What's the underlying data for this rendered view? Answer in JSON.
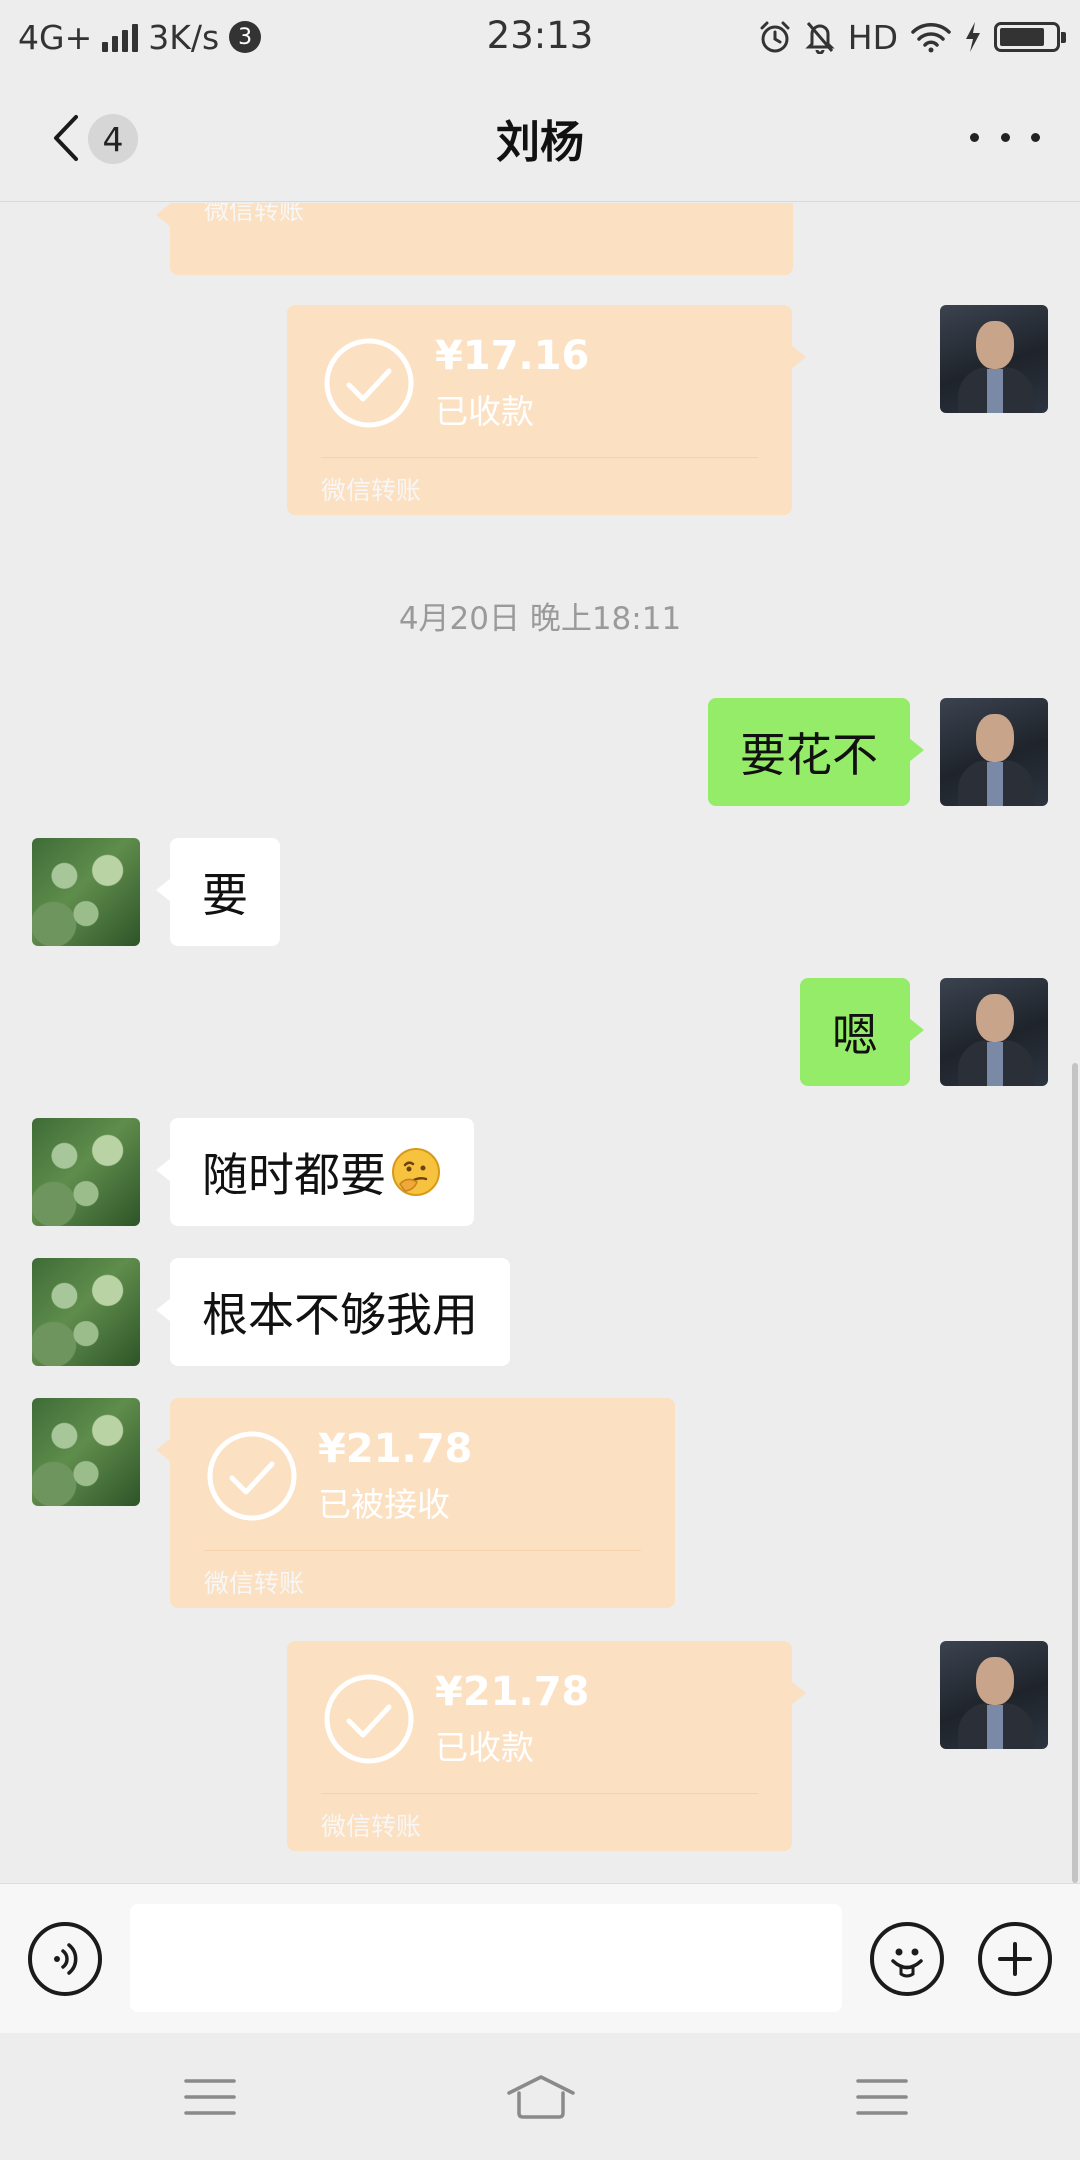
{
  "status_bar": {
    "network": "4G+",
    "speed": "3K/s",
    "notif_count": "3",
    "time": "23:13",
    "hd": "HD"
  },
  "header": {
    "back_badge": "4",
    "title": "刘杨"
  },
  "messages": {
    "top_transfer": {
      "footer": "微信转账"
    },
    "transfer1": {
      "amount": "¥17.16",
      "status": "已收款",
      "footer": "微信转账"
    },
    "timestamp": "4月20日 晚上18:11",
    "msg1": "要花不",
    "msg2": "要",
    "msg3": "嗯",
    "msg4": "随时都要",
    "msg5": "根本不够我用",
    "transfer2": {
      "amount": "¥21.78",
      "status": "已被接收",
      "footer": "微信转账"
    },
    "transfer3": {
      "amount": "¥21.78",
      "status": "已收款",
      "footer": "微信转账"
    }
  },
  "icons": {
    "back": "chevron-left-icon",
    "more": "more-dots-icon",
    "voice": "voice-icon",
    "emoji": "emoji-icon",
    "plus": "plus-icon",
    "transfer_check": "check-circle-icon",
    "thinking_emoji": "thinking-face-emoji",
    "nav_menu": "menu-icon",
    "nav_home": "home-icon",
    "nav_back": "menu-icon"
  },
  "colors": {
    "self_bubble": "#95ec69",
    "friend_bubble": "#ffffff",
    "transfer_card": "#fce0c2",
    "background": "#ededed"
  }
}
